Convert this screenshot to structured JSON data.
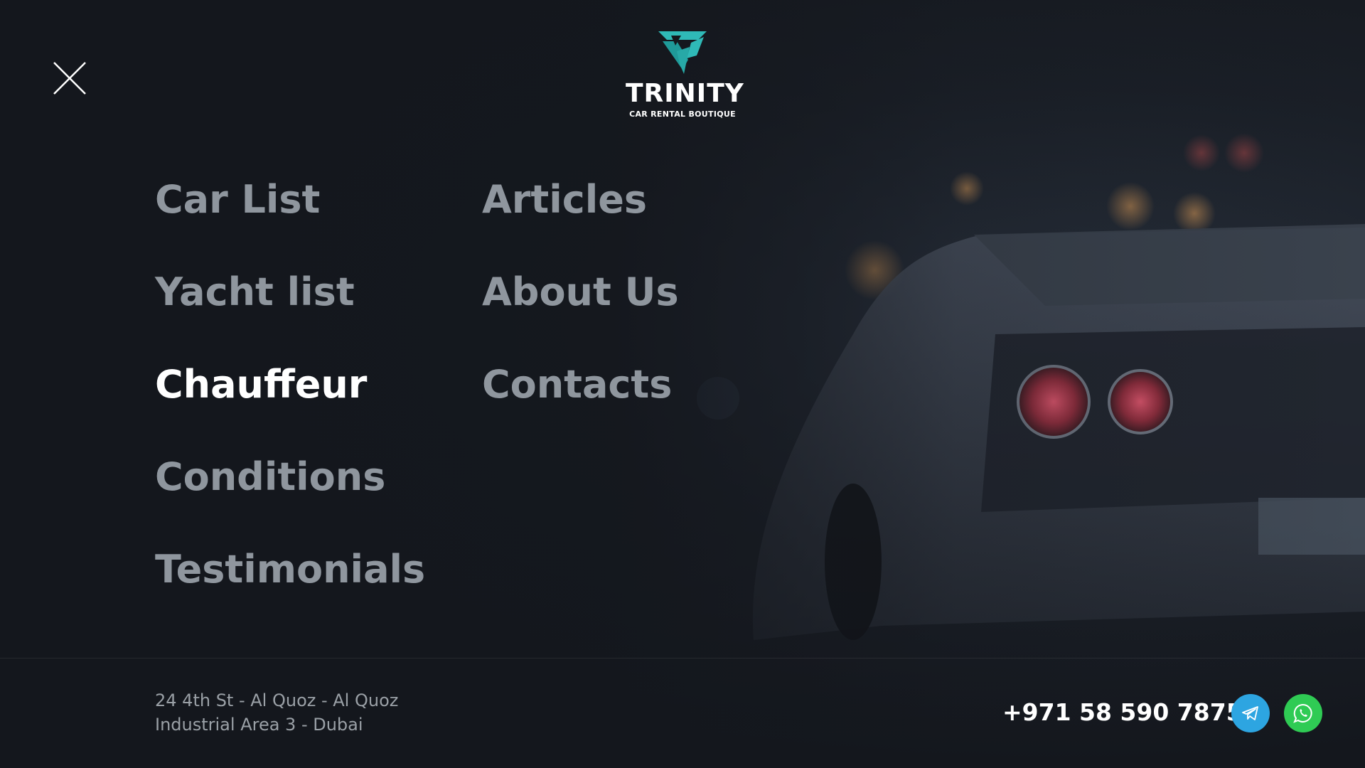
{
  "header": {
    "close_icon": "close-icon",
    "logo": {
      "name": "TRINITY",
      "tagline": "CAR RENTAL BOUTIQUE",
      "accent_color": "#2fb9b7"
    }
  },
  "menu": {
    "left_column": [
      {
        "label": "Car List",
        "active": false
      },
      {
        "label": "Yacht list",
        "active": false
      },
      {
        "label": "Chauffeur",
        "active": true
      },
      {
        "label": "Conditions",
        "active": false
      },
      {
        "label": "Testimonials",
        "active": false
      }
    ],
    "right_column": [
      {
        "label": "Articles",
        "active": false
      },
      {
        "label": "About Us",
        "active": false
      },
      {
        "label": "Contacts",
        "active": false
      }
    ],
    "active_color": "#ffffff",
    "inactive_color": "#8f969e",
    "underline_color": "#2fb9b7"
  },
  "footer": {
    "address_line1": "24 4th St - Al Quoz - Al Quoz",
    "address_line2": "Industrial Area 3 - Dubai",
    "phone": "+971 58 590 7875",
    "social": [
      {
        "icon": "telegram-icon",
        "color": "#2da5e1"
      },
      {
        "icon": "whatsapp-icon",
        "color": "#2fcb54"
      }
    ]
  }
}
